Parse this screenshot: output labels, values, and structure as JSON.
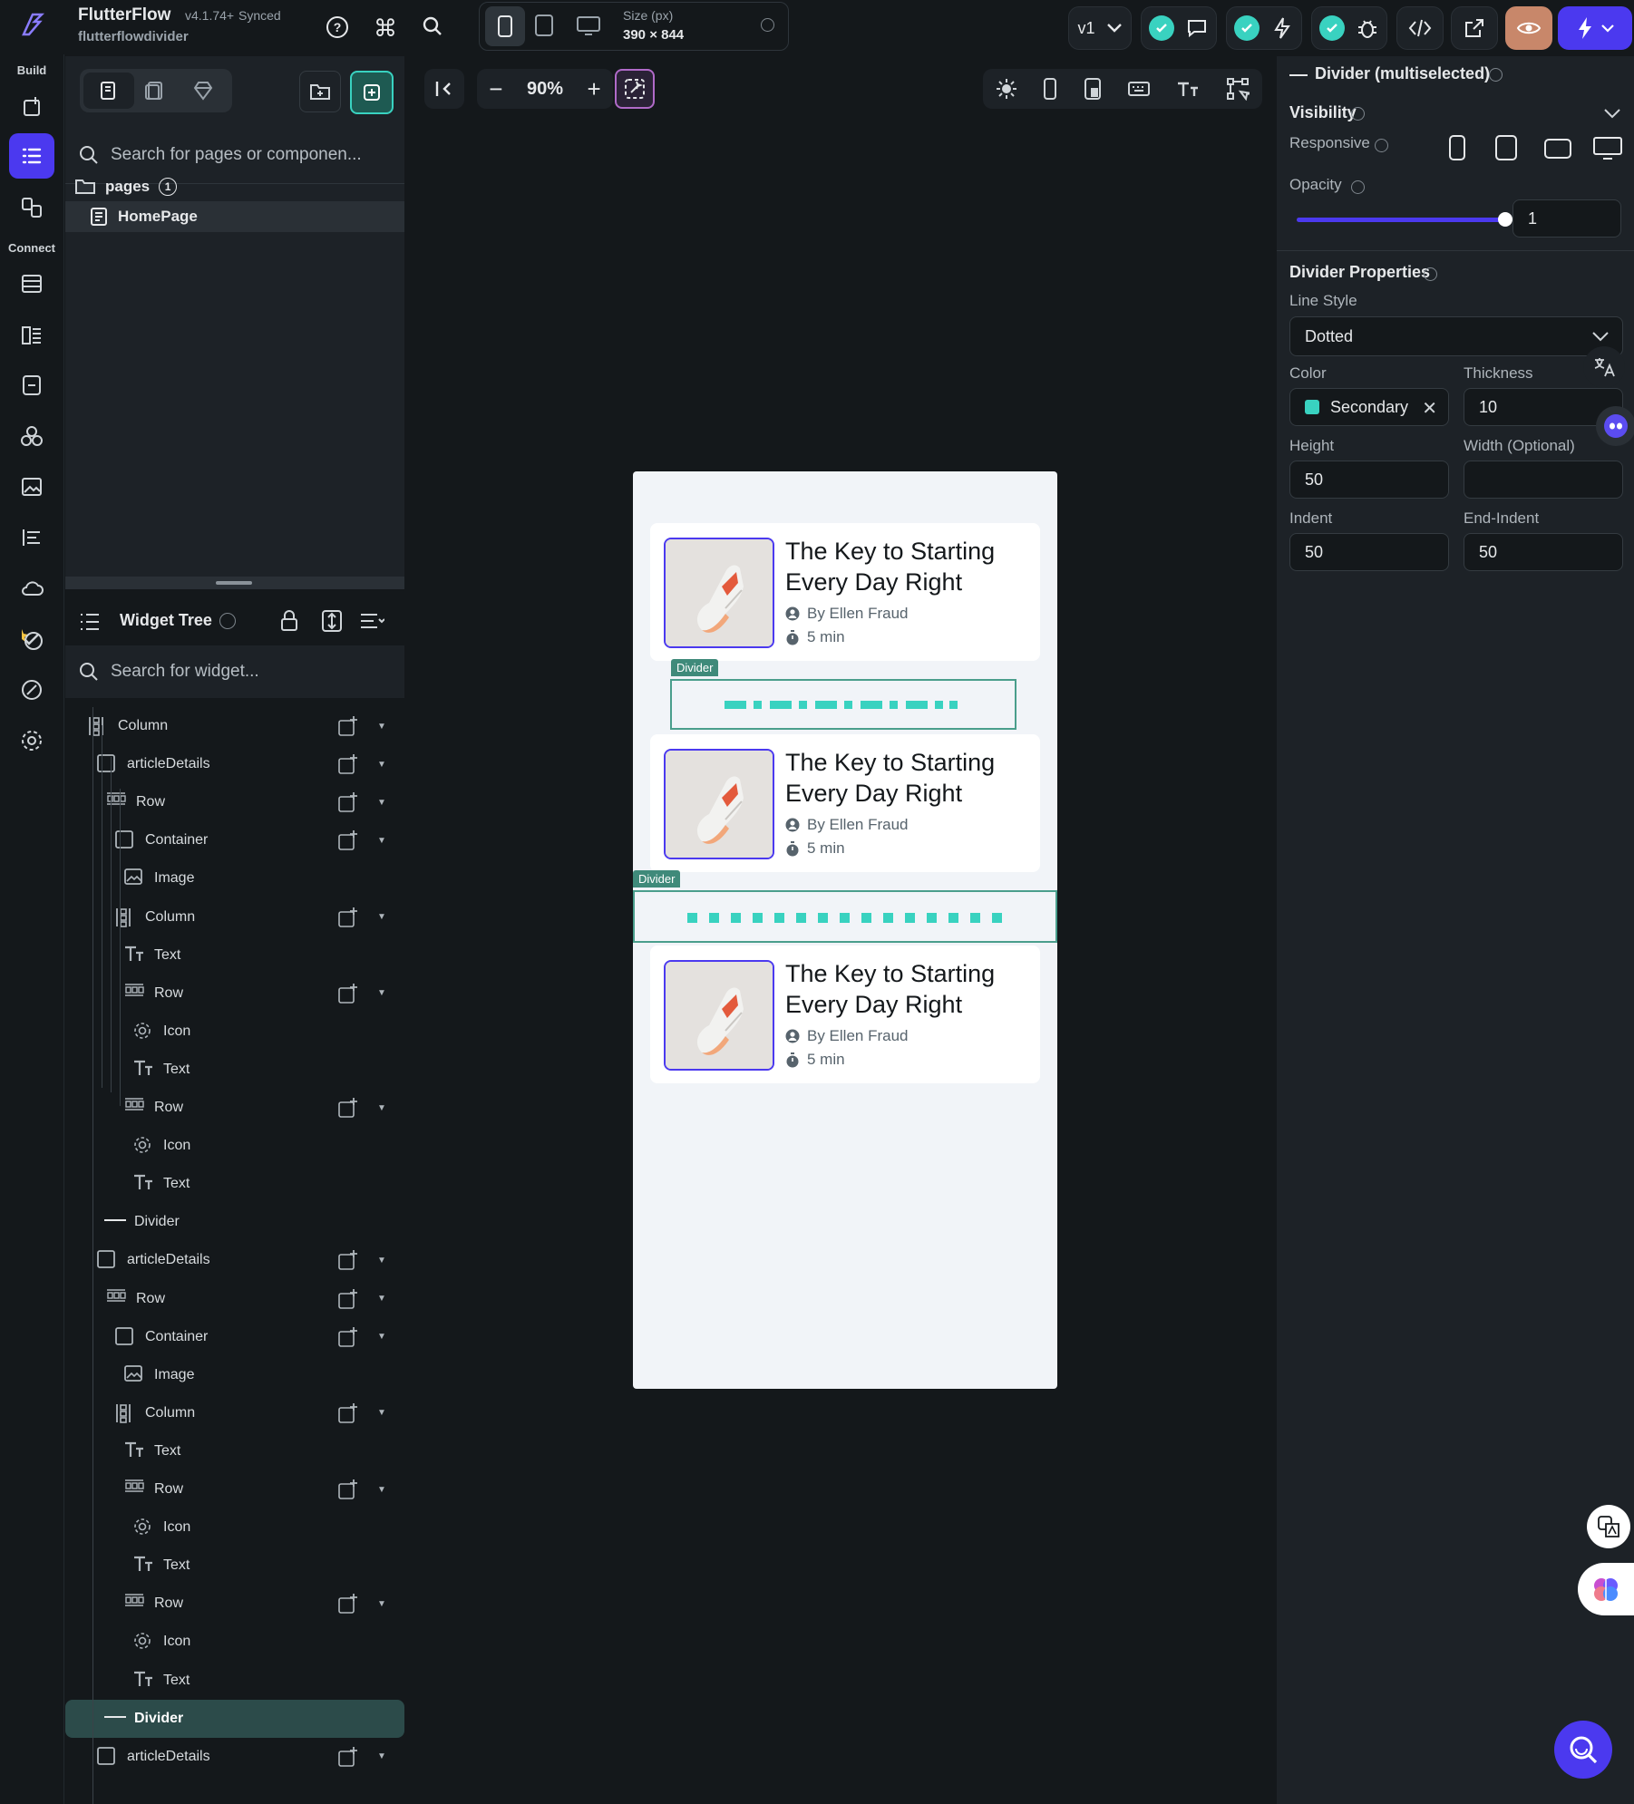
{
  "app": {
    "name": "FlutterFlow",
    "version": "v4.1.74+",
    "sync_status": "Synced",
    "project": "flutterflowdivider"
  },
  "topbar": {
    "size_label": "Size (px)",
    "size_value": "390 × 844",
    "version_menu": "v1"
  },
  "rail": {
    "build_label": "Build",
    "connect_label": "Connect"
  },
  "left_panel": {
    "page_search_placeholder": "Search for pages or componen...",
    "pages_folder": "pages",
    "pages_count": "1",
    "selected_page": "HomePage",
    "widget_tree_title": "Widget Tree",
    "widget_search_placeholder": "Search for widget...",
    "tree": [
      {
        "label": "Column",
        "icon": "column",
        "indent": 0,
        "add": true
      },
      {
        "label": "articleDetails",
        "icon": "container",
        "indent": 1,
        "add": true
      },
      {
        "label": "Row",
        "icon": "row",
        "indent": 2,
        "add": true
      },
      {
        "label": "Container",
        "icon": "container",
        "indent": 3,
        "add": true
      },
      {
        "label": "Image",
        "icon": "image",
        "indent": 4,
        "add": false
      },
      {
        "label": "Column",
        "icon": "column",
        "indent": 3,
        "add": true
      },
      {
        "label": "Text",
        "icon": "text",
        "indent": 4,
        "add": false
      },
      {
        "label": "Row",
        "icon": "row",
        "indent": 4,
        "add": true
      },
      {
        "label": "Icon",
        "icon": "gear",
        "indent": 5,
        "add": false
      },
      {
        "label": "Text",
        "icon": "text",
        "indent": 5,
        "add": false
      },
      {
        "label": "Row",
        "icon": "row",
        "indent": 4,
        "add": true
      },
      {
        "label": "Icon",
        "icon": "gear",
        "indent": 5,
        "add": false
      },
      {
        "label": "Text",
        "icon": "text",
        "indent": 5,
        "add": false
      },
      {
        "label": "Divider",
        "icon": "divider",
        "indent": 1,
        "add": false
      },
      {
        "label": "articleDetails",
        "icon": "container",
        "indent": 1,
        "add": true
      },
      {
        "label": "Row",
        "icon": "row",
        "indent": 2,
        "add": true
      },
      {
        "label": "Container",
        "icon": "container",
        "indent": 3,
        "add": true
      },
      {
        "label": "Image",
        "icon": "image",
        "indent": 4,
        "add": false
      },
      {
        "label": "Column",
        "icon": "column",
        "indent": 3,
        "add": true
      },
      {
        "label": "Text",
        "icon": "text",
        "indent": 4,
        "add": false
      },
      {
        "label": "Row",
        "icon": "row",
        "indent": 4,
        "add": true
      },
      {
        "label": "Icon",
        "icon": "gear",
        "indent": 5,
        "add": false
      },
      {
        "label": "Text",
        "icon": "text",
        "indent": 5,
        "add": false
      },
      {
        "label": "Row",
        "icon": "row",
        "indent": 4,
        "add": true
      },
      {
        "label": "Icon",
        "icon": "gear",
        "indent": 5,
        "add": false
      },
      {
        "label": "Text",
        "icon": "text",
        "indent": 5,
        "add": false
      },
      {
        "label": "Divider",
        "icon": "divider",
        "indent": 1,
        "add": false,
        "selected": true
      },
      {
        "label": "articleDetails",
        "icon": "container",
        "indent": 1,
        "add": true
      }
    ]
  },
  "canvas": {
    "zoom": "90%",
    "divider_tag": "Divider",
    "articles": [
      {
        "title": "The Key to Starting Every Day Right",
        "author": "By Ellen Fraud",
        "read_time": "5 min"
      },
      {
        "title": "The Key to Starting Every Day Right",
        "author": "By Ellen Fraud",
        "read_time": "5 min"
      },
      {
        "title": "The Key to Starting Every Day Right",
        "author": "By Ellen Fraud",
        "read_time": "5 min"
      }
    ]
  },
  "right_panel": {
    "title": "Divider (multiselected)",
    "visibility_title": "Visibility",
    "responsive_label": "Responsive",
    "opacity_label": "Opacity",
    "opacity_value": "1",
    "opacity_level": 1.0,
    "props_title": "Divider Properties",
    "line_style_label": "Line Style",
    "line_style_value": "Dotted",
    "color_label": "Color",
    "color_value": "Secondary",
    "thickness_label": "Thickness",
    "thickness_value": "10",
    "height_label": "Height",
    "height_value": "50",
    "width_label": "Width (Optional)",
    "width_value": "",
    "indent_label": "Indent",
    "indent_value": "50",
    "end_indent_label": "End-Indent",
    "end_indent_value": "50"
  },
  "colors": {
    "primary": "#4b39ef",
    "secondary": "#39d2c0",
    "divider_select": "#4a9e8c"
  }
}
